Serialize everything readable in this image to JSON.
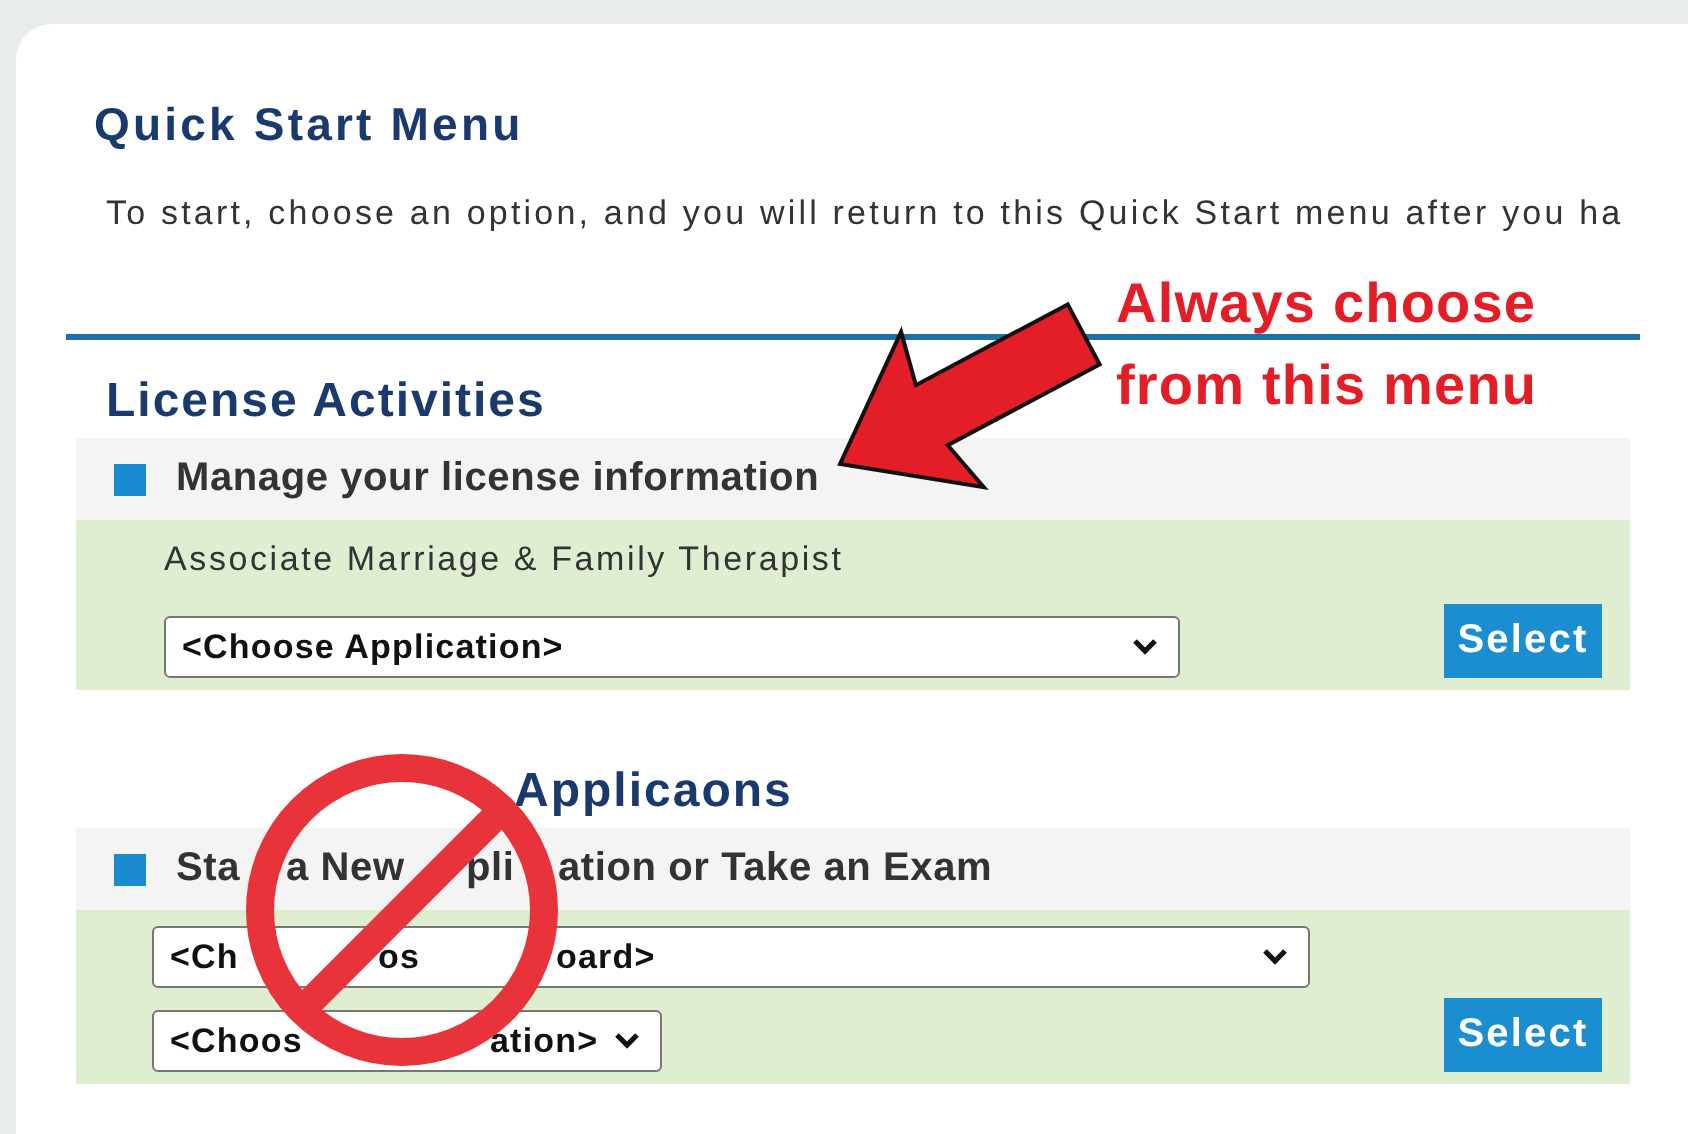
{
  "title": "Quick Start Menu",
  "intro": "To start, choose an option, and you will return to this Quick Start menu after you ha",
  "sections": [
    {
      "heading": [
        "License Activities"
      ],
      "item": [
        "Manage your license information"
      ],
      "label": "Associate Marriage & Family Therapist",
      "dropdowns": [
        {
          "value": [
            "<Choose Application>"
          ],
          "kind": "wide"
        }
      ],
      "button": "Select"
    },
    {
      "heading": [
        "Applica",
        "ons"
      ],
      "item": [
        "Sta",
        "a New",
        "pli",
        "ation or Take an Exam"
      ],
      "dropdowns": [
        {
          "value": [
            "<Ch",
            "os",
            "oard>"
          ],
          "kind": "wide"
        },
        {
          "value": [
            "<Choos",
            "ation>"
          ],
          "kind": "narrow"
        }
      ],
      "button": "Select"
    }
  ],
  "annotation": {
    "text": "Always choose\nfrom this menu"
  }
}
